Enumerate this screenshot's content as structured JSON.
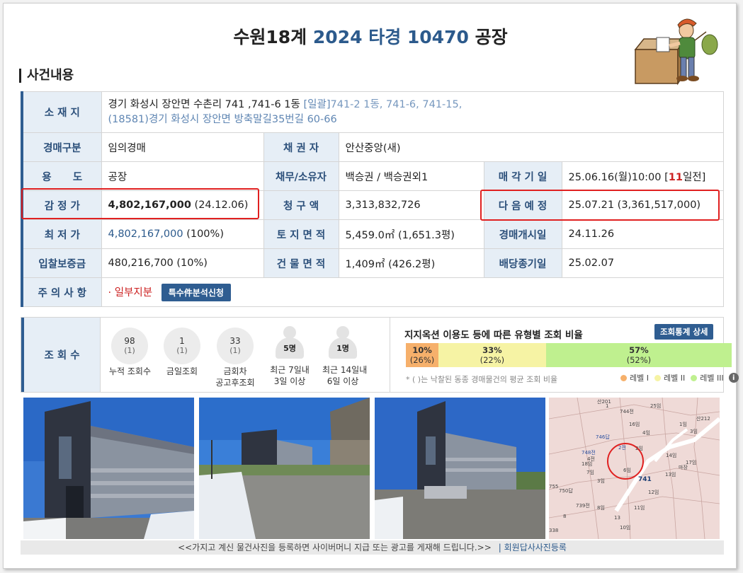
{
  "header": {
    "court": "수원18계",
    "case_no": "2024 타경 10470",
    "category": "공장"
  },
  "section_title": "사건내용",
  "info": {
    "location_label": "소 재 지",
    "location_line1": "경기 화성시 장안면 수촌리 741 ,741-6 1동",
    "location_bulk_tag": "[일괄]",
    "location_bulk": "741-2 1동, 741-6, 741-15,",
    "location_line2": "(18581)경기 화성시  장안면 방축말길35번길  60-66",
    "auction_type_label": "경매구분",
    "auction_type": "임의경매",
    "creditor_label": "채 권 자",
    "creditor": "안산중앙(새)",
    "usage_label": "용      도",
    "usage": "공장",
    "debtor_label": "채무/소유자",
    "debtor": "백승권 /  백승권외1",
    "sale_date_label": "매 각 기 일",
    "sale_date": "25.06.16(월)10:00 [",
    "sale_dday": "11",
    "sale_dday_suffix": "일전]",
    "appraisal_label": "감 정 가",
    "appraisal_value": "4,802,167,000",
    "appraisal_date": "(24.12.06)",
    "claim_label": "청 구 액",
    "claim_value": "3,313,832,726",
    "next_label": "다 음 예 정",
    "next_value": "25.07.21 (3,361,517,000)",
    "minimum_label": "최 저 가",
    "minimum_value": "4,802,167,000",
    "minimum_pct": "(100%)",
    "land_label": "토 지 면 적",
    "land_value": "5,459.0㎡ (1,651.3평)",
    "start_label": "경매개시일",
    "start_value": "24.11.26",
    "deposit_label": "입찰보증금",
    "deposit_value": "480,216,700 (10%)",
    "building_label": "건 물 면 적",
    "building_value": "1,409㎡ (426.2평)",
    "dividend_label": "배당종기일",
    "dividend_value": "25.02.07",
    "caution_label": "주 의 사 항",
    "caution_value": "· 일부지분",
    "special_button": "특수件분석신청"
  },
  "views": {
    "label": "조 회 수",
    "items": [
      {
        "count": "98",
        "sub": "(1)",
        "caption": "누적 조회수"
      },
      {
        "count": "1",
        "sub": "(1)",
        "caption": "금일조회"
      },
      {
        "count": "33",
        "sub": "(1)",
        "caption1": "금회차",
        "caption2": "공고후조회"
      }
    ],
    "recent7": {
      "count": "5명",
      "caption1": "최근 7일내",
      "caption2": "3일 이상"
    },
    "recent14": {
      "count": "1명",
      "caption1": "최근 14일내",
      "caption2": "6일 이상"
    }
  },
  "ratio": {
    "title": "지지옥션 이용도 등에 따른 유형별 조회 비율",
    "button": "조회통계 상세",
    "segments": [
      {
        "pct": "10%",
        "avg": "(26%)",
        "value": 10,
        "color": "#f6b06b"
      },
      {
        "pct": "33%",
        "avg": "(22%)",
        "value": 33,
        "color": "#f6f3a4"
      },
      {
        "pct": "57%",
        "avg": "(52%)",
        "value": 57,
        "color": "#bff08f"
      }
    ],
    "note": "* ( )는 낙찰된 동종 경매물건의 평균 조회 비율",
    "legend": [
      "레벨 I",
      "레벨 II",
      "레벨 III"
    ]
  },
  "map_labels": [
    "산201",
    "1",
    "25임",
    "744전",
    "16임",
    "4임",
    "1임",
    "산212",
    "3임",
    "746답",
    "2전",
    "2임",
    "14임",
    "17임",
    "748전",
    "4전",
    "18임",
    "마장",
    "7임",
    "6임",
    "13임",
    "741",
    "3임",
    "755",
    "750답",
    "12임",
    "739전",
    "8임",
    "11임",
    "13",
    "8",
    "338",
    "10임"
  ],
  "footer": {
    "text": "<<가지고 계신 물건사진을 등록하면 사이버머니 지급 또는 광고를 게재해 드립니다.>>",
    "link": "| 회원답사사진등록"
  }
}
